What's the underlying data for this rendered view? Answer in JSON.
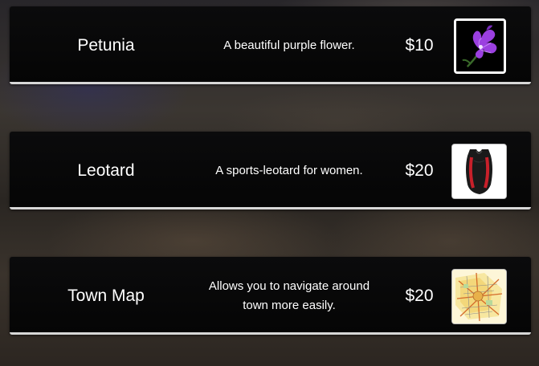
{
  "shop": {
    "items": [
      {
        "name": "Petunia",
        "description": "A beautiful purple flower.",
        "price": "$10",
        "icon": "petunia-flower-icon"
      },
      {
        "name": "Leotard",
        "description": "A sports-leotard for women.",
        "price": "$20",
        "icon": "leotard-icon"
      },
      {
        "name": "Town Map",
        "description": "Allows you to navigate around town more easily.",
        "price": "$20",
        "icon": "town-map-icon"
      }
    ]
  },
  "colors": {
    "panel": "#050505",
    "panel_border": "#d7d7d7",
    "text": "#ffffff",
    "flower_purple": "#9b3fe0"
  }
}
